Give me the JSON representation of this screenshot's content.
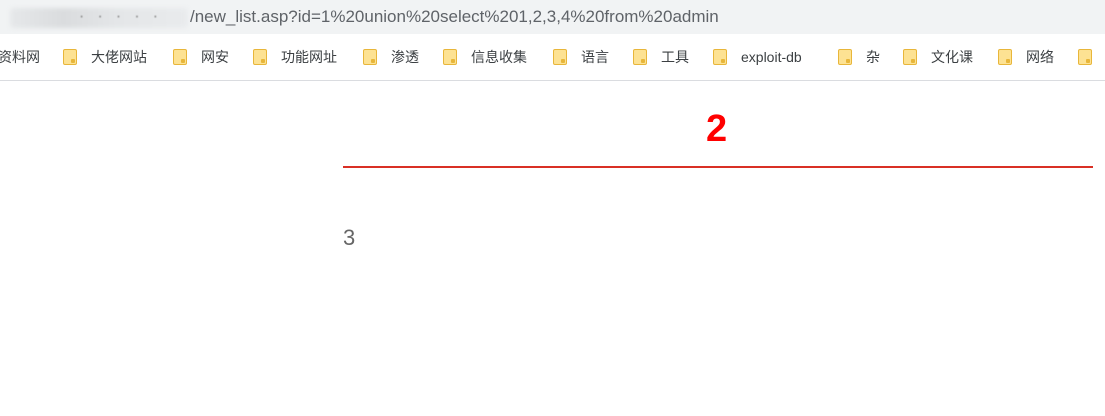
{
  "address_bar": {
    "obscured_prefix": "· · · · ·",
    "url_path": "/new_list.asp?id=1%20union%20select%201,2,3,4%20from%20admin"
  },
  "bookmarks": [
    {
      "label": "资料网",
      "icon": "folder-icon"
    },
    {
      "label": "大佬网站",
      "icon": "folder-icon"
    },
    {
      "label": "网安",
      "icon": "folder-icon"
    },
    {
      "label": "功能网址",
      "icon": "folder-icon"
    },
    {
      "label": "渗透",
      "icon": "folder-icon"
    },
    {
      "label": "信息收集",
      "icon": "folder-icon"
    },
    {
      "label": "语言",
      "icon": "folder-icon"
    },
    {
      "label": "工具",
      "icon": "folder-icon"
    },
    {
      "label": "exploit-db",
      "icon": "folder-icon"
    },
    {
      "label": "杂",
      "icon": "folder-icon"
    },
    {
      "label": "文化课",
      "icon": "folder-icon"
    },
    {
      "label": "网络",
      "icon": "folder-icon"
    }
  ],
  "page": {
    "heading": "2",
    "body": "3"
  },
  "colors": {
    "heading": "#ff0000",
    "rule": "#d93025",
    "folder": "#fde293"
  }
}
